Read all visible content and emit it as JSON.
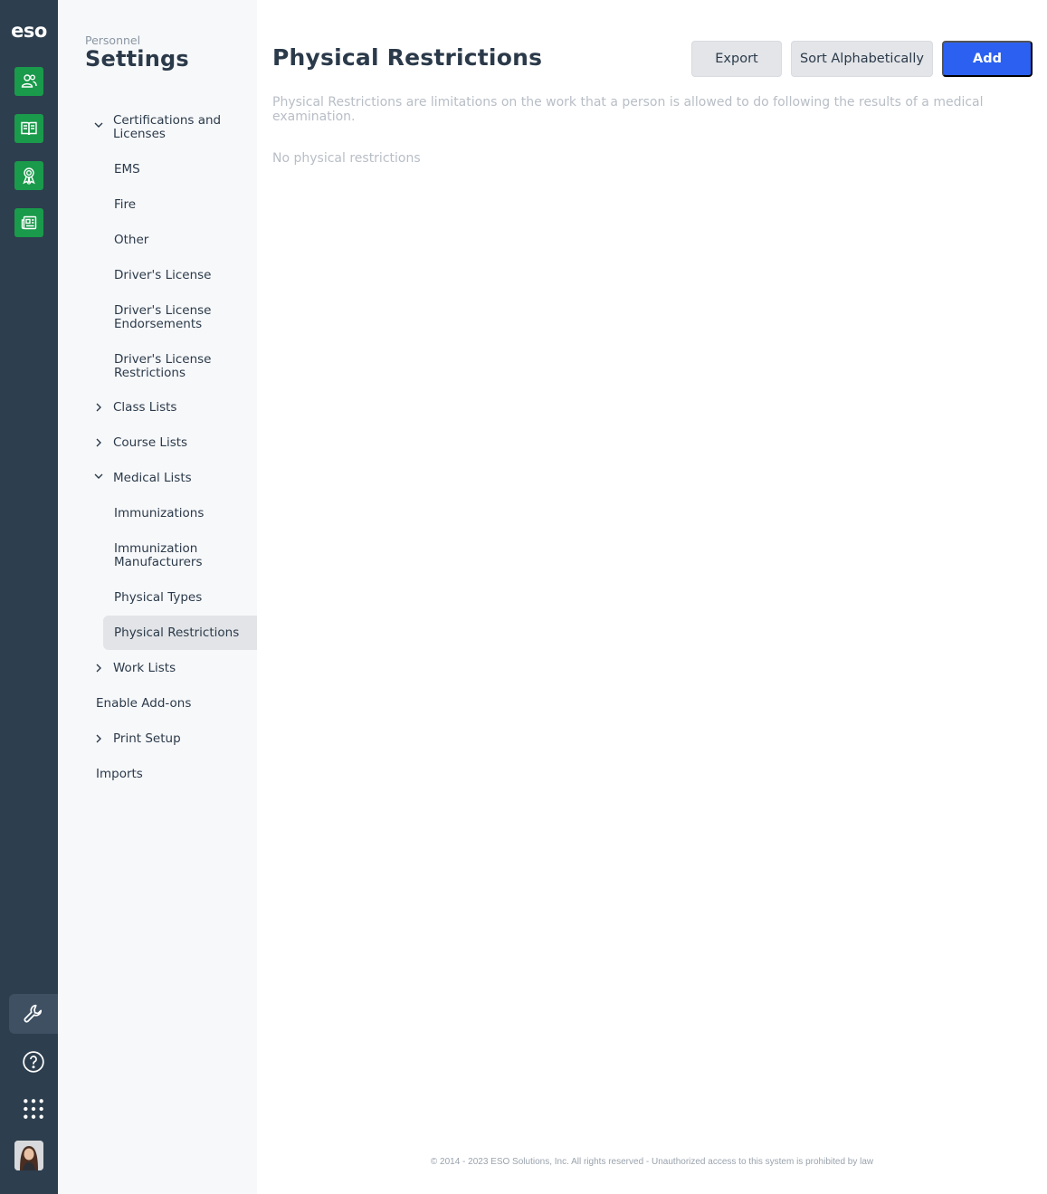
{
  "rail": {
    "logo": "eso",
    "apps": [
      {
        "icon": "people-icon"
      },
      {
        "icon": "book-icon"
      },
      {
        "icon": "award-icon"
      },
      {
        "icon": "newspaper-icon"
      }
    ],
    "bottom": [
      {
        "icon": "wrench-icon",
        "active": true
      },
      {
        "icon": "help-icon"
      },
      {
        "icon": "app-grid-icon"
      }
    ],
    "avatar_icon": "user-avatar"
  },
  "sidenav": {
    "eyebrow": "Personnel",
    "title": "Settings",
    "items": [
      {
        "label": "Certifications and Licenses",
        "chevron": "down"
      },
      {
        "label": "EMS"
      },
      {
        "label": "Fire"
      },
      {
        "label": "Other"
      },
      {
        "label": "Driver's License"
      },
      {
        "label": "Driver's License Endorsements"
      },
      {
        "label": "Driver's License Restrictions"
      },
      {
        "label": "Class Lists",
        "chevron": "right"
      },
      {
        "label": "Course Lists",
        "chevron": "right"
      },
      {
        "label": "Medical Lists",
        "chevron": "down"
      },
      {
        "label": "Immunizations"
      },
      {
        "label": "Immunization Manufacturers"
      },
      {
        "label": "Physical Types"
      },
      {
        "label": "Physical Restrictions",
        "active": true
      },
      {
        "label": "Work Lists",
        "chevron": "right"
      },
      {
        "label": "Enable Add-ons"
      },
      {
        "label": "Print Setup",
        "chevron": "right"
      },
      {
        "label": "Imports"
      }
    ]
  },
  "main": {
    "title": "Physical Restrictions",
    "buttons": {
      "export": "Export",
      "sort": "Sort Alphabetically",
      "add": "Add"
    },
    "description": "Physical Restrictions are limitations on the work that a person is allowed to do following the results of a medical examination.",
    "empty_state": "No physical restrictions",
    "footer": "© 2014 - 2023 ESO Solutions, Inc. All rights reserved - Unauthorized access to this system is prohibited by law"
  },
  "colors": {
    "rail_bg": "#2d3e4e",
    "app_green": "#1a9a4b",
    "primary_blue": "#2b60f0",
    "sidenav_bg": "#f7f8fa",
    "active_item_bg": "#e2e4e7"
  }
}
